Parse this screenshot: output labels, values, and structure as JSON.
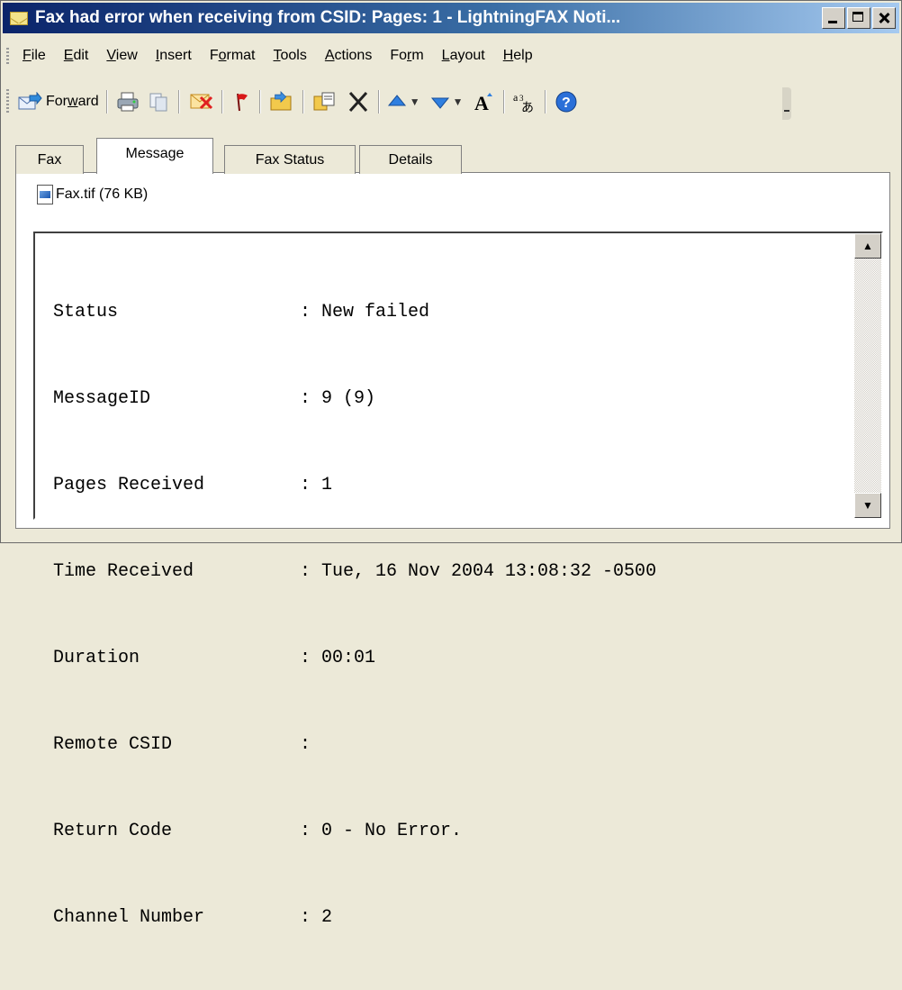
{
  "window": {
    "title": "Fax had error when receiving from CSID:   Pages: 1 - LightningFAX Noti..."
  },
  "menubar": [
    {
      "pre": "",
      "ul": "F",
      "post": "ile"
    },
    {
      "pre": "",
      "ul": "E",
      "post": "dit"
    },
    {
      "pre": "",
      "ul": "V",
      "post": "iew"
    },
    {
      "pre": "",
      "ul": "I",
      "post": "nsert"
    },
    {
      "pre": "F",
      "ul": "o",
      "post": "rmat"
    },
    {
      "pre": "",
      "ul": "T",
      "post": "ools"
    },
    {
      "pre": "",
      "ul": "A",
      "post": "ctions"
    },
    {
      "pre": "Fo",
      "ul": "r",
      "post": "m"
    },
    {
      "pre": "",
      "ul": "L",
      "post": "ayout"
    },
    {
      "pre": "",
      "ul": "H",
      "post": "elp"
    }
  ],
  "toolbar": {
    "forward_label_pre": "For",
    "forward_label_ul": "w",
    "forward_label_post": "ard",
    "icons": [
      "forward-icon",
      "print-icon",
      "copy-icon",
      "reply-icon",
      "flag-icon",
      "move-to-folder-icon",
      "copy-to-folder-icon",
      "delete-icon",
      "previous-item-icon",
      "next-item-icon",
      "font-size-icon",
      "encoding-icon",
      "help-icon"
    ]
  },
  "tabs": [
    "Fax",
    "Message",
    "Fax Status",
    "Details"
  ],
  "active_tab": "Message",
  "attachment": "Fax.tif (76 KB)",
  "message_rows": [
    {
      "key": "Status",
      "value": ": New failed"
    },
    {
      "key": "MessageID",
      "value": ": 9 (9)"
    },
    {
      "key": "Pages Received",
      "value": ": 1"
    },
    {
      "key": "Time Received",
      "value": ": Tue, 16 Nov 2004 13:08:32 -0500"
    },
    {
      "key": "Duration",
      "value": ": 00:01"
    },
    {
      "key": "Remote CSID",
      "value": ":"
    },
    {
      "key": "Return Code",
      "value": ": 0 - No Error."
    },
    {
      "key": "Channel Number",
      "value": ": 2"
    }
  ],
  "colors": {
    "titlebar_start": "#0a246a",
    "titlebar_end": "#a6caf0",
    "chrome": "#ece9d8"
  }
}
